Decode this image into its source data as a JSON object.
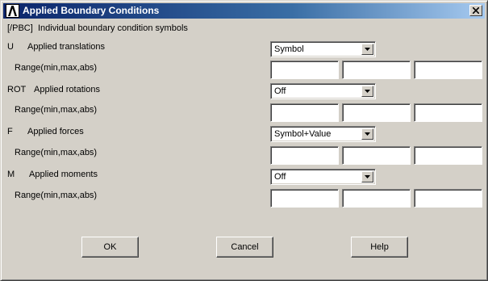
{
  "window": {
    "title": "Applied Boundary Conditions",
    "close_label": "×"
  },
  "header": {
    "command": "[/PBC]",
    "description": "Individual boundary condition symbols"
  },
  "rows": [
    {
      "code": "U",
      "label": "Applied translations",
      "selected": "Symbol",
      "range_label": "Range(min,max,abs)",
      "range_values": [
        "",
        "",
        ""
      ]
    },
    {
      "code": "ROT",
      "label": "Applied rotations",
      "selected": "Off",
      "range_label": "Range(min,max,abs)",
      "range_values": [
        "",
        "",
        ""
      ]
    },
    {
      "code": "F",
      "label": "Applied forces",
      "selected": "Symbol+Value",
      "range_label": "Range(min,max,abs)",
      "range_values": [
        "",
        "",
        ""
      ]
    },
    {
      "code": "M",
      "label": "Applied moments",
      "selected": "Off",
      "range_label": "Range(min,max,abs)",
      "range_values": [
        "",
        "",
        ""
      ]
    }
  ],
  "buttons": {
    "ok": "OK",
    "cancel": "Cancel",
    "help": "Help"
  },
  "colors": {
    "titlebar_start": "#0a246a",
    "titlebar_end": "#a6caf0",
    "dialog_bg": "#d4d0c8"
  },
  "icons": {
    "app": "ansys-logo-icon",
    "close": "close-icon",
    "dropdown": "chevron-down-icon"
  }
}
